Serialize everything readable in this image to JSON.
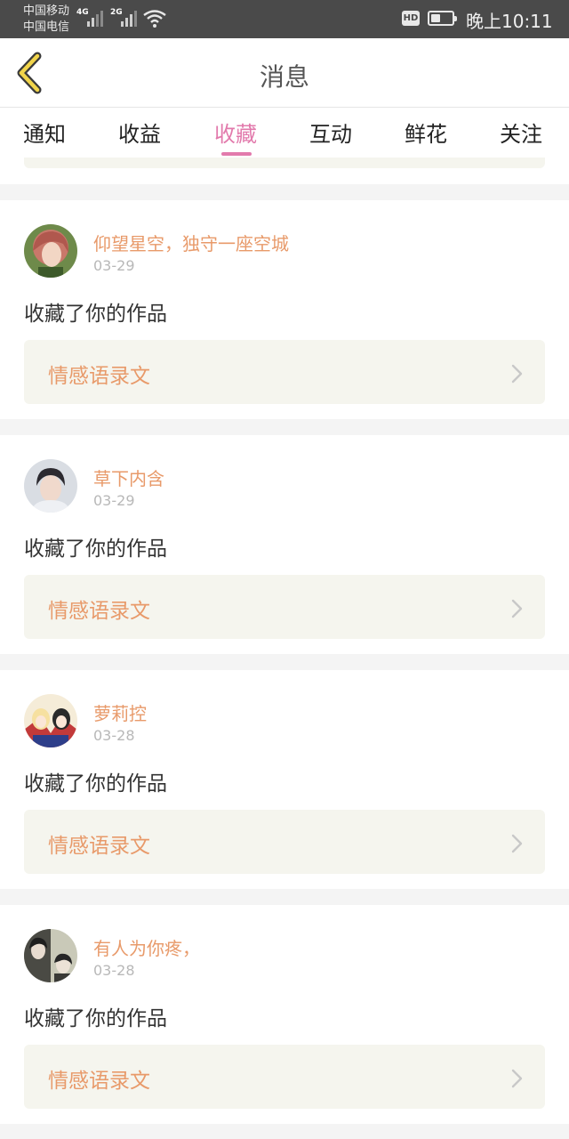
{
  "status_bar": {
    "carrier1": "中国移动",
    "carrier2": "中国电信",
    "net1": "4G",
    "net2": "2G",
    "hd": "HD",
    "battery_level": 0.45,
    "time": "晚上10:11"
  },
  "header": {
    "back_icon": "chevron-left-icon",
    "title": "消息"
  },
  "tabs": [
    {
      "label": "通知"
    },
    {
      "label": "收益"
    },
    {
      "label": "收藏"
    },
    {
      "label": "互动"
    },
    {
      "label": "鲜花"
    },
    {
      "label": "关注"
    }
  ],
  "active_tab": "收藏",
  "colors": {
    "accent": "#e27aac",
    "name": "#e89a6a",
    "work_bg": "#f5f5ee"
  },
  "items": [
    {
      "name": "仰望星空，独守一座空城",
      "date": "03-29",
      "action": "收藏了你的作品",
      "work": "情感语录文"
    },
    {
      "name": "草下内含",
      "date": "03-29",
      "action": "收藏了你的作品",
      "work": "情感语录文"
    },
    {
      "name": "萝莉控",
      "date": "03-28",
      "action": "收藏了你的作品",
      "work": "情感语录文"
    },
    {
      "name": "有人为你疼，",
      "date": "03-28",
      "action": "收藏了你的作品",
      "work": "情感语录文"
    }
  ]
}
